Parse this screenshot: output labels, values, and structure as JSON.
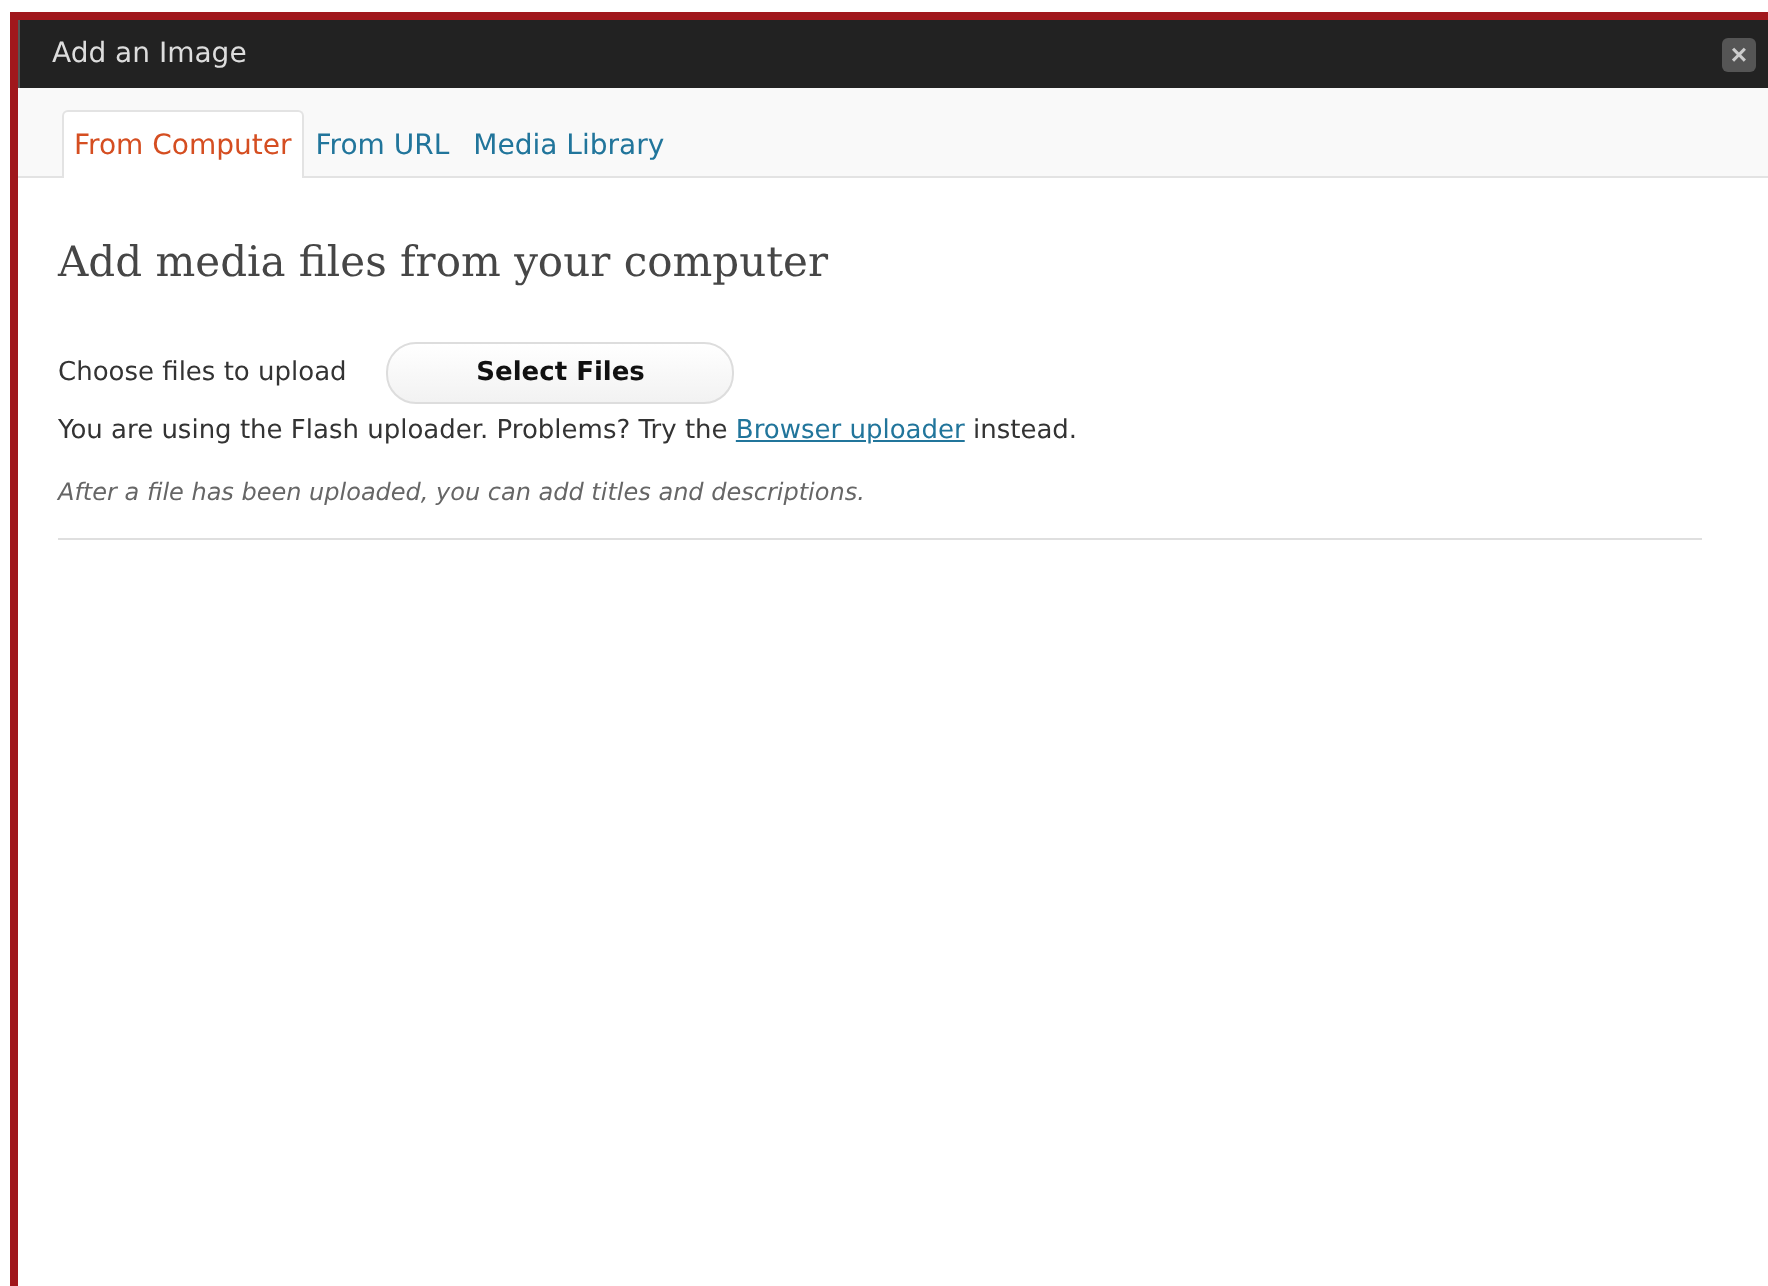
{
  "window": {
    "title": "Add an Image",
    "close": "×"
  },
  "tabs": [
    {
      "label": "From Computer",
      "selected": true
    },
    {
      "label": "From URL",
      "selected": false
    },
    {
      "label": "Media Library",
      "selected": false
    }
  ],
  "heading": "Add media files from your computer",
  "upload": {
    "label": "Choose files to upload",
    "button": "Select Files"
  },
  "notice": {
    "before": "You are using the Flash uploader. Problems? Try the ",
    "link": "Browser uploader",
    "after": " instead."
  },
  "hint": "After a file has been uploaded, you can add titles and descriptions."
}
